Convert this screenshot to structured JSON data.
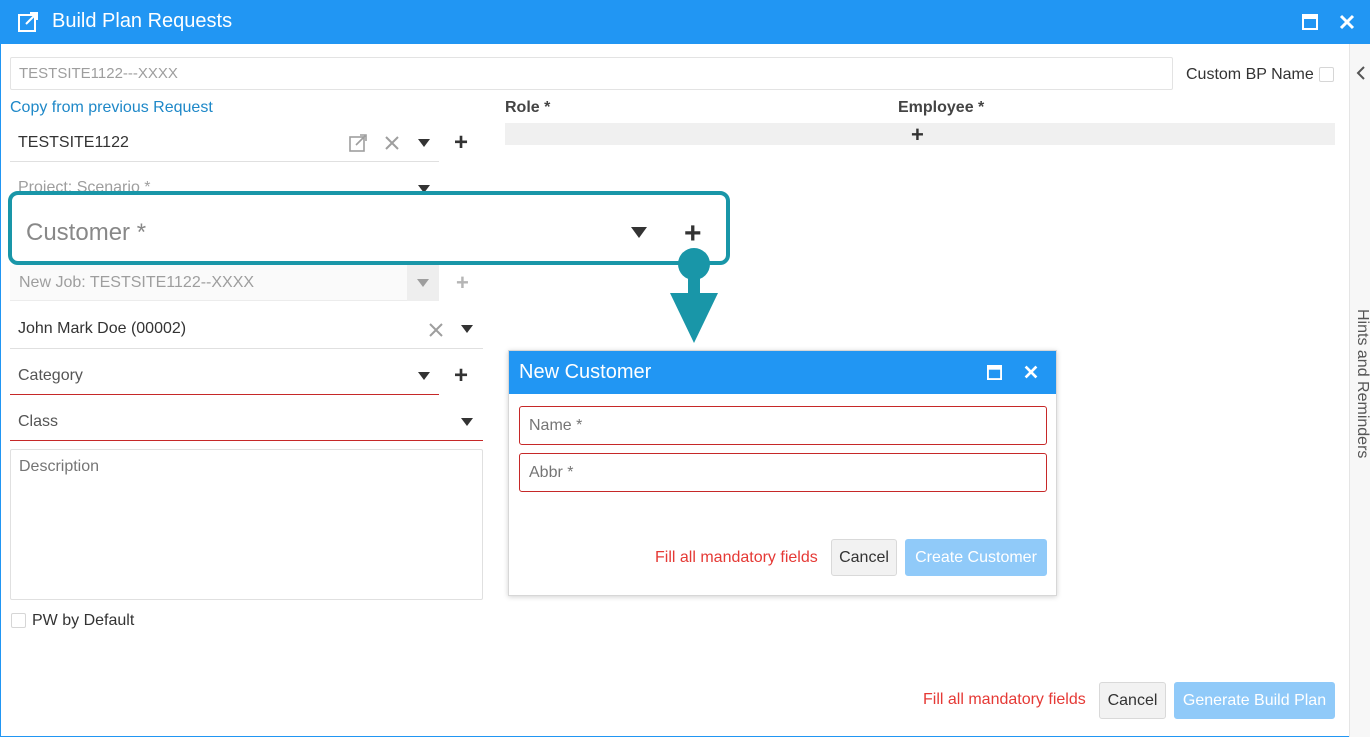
{
  "window": {
    "title": "Build Plan Requests",
    "colors": {
      "accent": "#2196f3",
      "highlight": "#1996a8",
      "error": "#e53935",
      "disabled_button": "#90caf9"
    }
  },
  "form": {
    "bp_name_value": "TESTSITE1122---XXXX",
    "custom_bp_name_label": "Custom BP Name",
    "copy_link": "Copy from previous Request",
    "site_value": "TESTSITE1122",
    "project_scenario_placeholder": "Project: Scenario *",
    "customer_placeholder": "Customer *",
    "job_value": "New Job: TESTSITE1122--XXXX",
    "employee_value": "John Mark Doe (00002)",
    "category_placeholder": "Category",
    "class_placeholder": "Class",
    "description_placeholder": "Description",
    "pw_default_label": "PW by Default"
  },
  "assignments": {
    "role_header": "Role *",
    "employee_header": "Employee *",
    "add_symbol": "+"
  },
  "hints": {
    "label": "Hints and Reminders"
  },
  "footer": {
    "warning": "Fill all mandatory fields",
    "cancel_label": "Cancel",
    "generate_label": "Generate Build Plan"
  },
  "dialog": {
    "title": "New Customer",
    "name_placeholder": "Name *",
    "abbr_placeholder": "Abbr *",
    "warning": "Fill all mandatory fields",
    "cancel_label": "Cancel",
    "create_label": "Create Customer"
  },
  "icons": [
    "external-link-icon",
    "maximize-icon",
    "close-icon",
    "clear-icon",
    "dropdown-caret-icon",
    "plus-icon",
    "chevron-left-icon"
  ]
}
